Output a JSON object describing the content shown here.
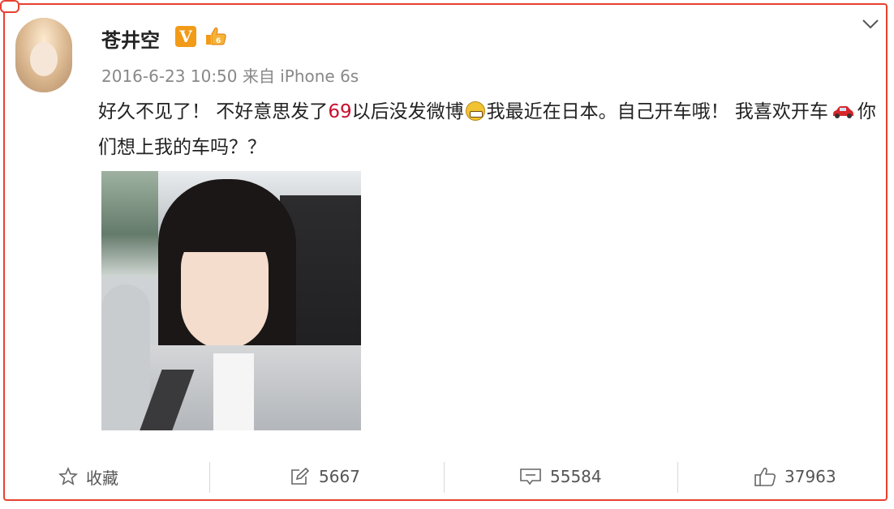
{
  "user": {
    "name": "苍井空",
    "meta": "2016-6-23 10:50 来自 iPhone 6s"
  },
  "post": {
    "text_part1": "好久不见了！ 不好意思发了",
    "text_highlight": "69",
    "text_part2": "以后没发微博",
    "text_part3": "我最近在日本。自己开车哦！ 我喜欢开车",
    "text_part4": "你们想上我的车吗？？"
  },
  "actions": {
    "favorite_label": "收藏",
    "repost_count": "5667",
    "comment_count": "55584",
    "like_count": "37963"
  },
  "icons": {
    "vip_badge": "V",
    "vip_color": "#f29b18",
    "highlight_color": "#c8102e",
    "border_color": "#e8412f"
  }
}
